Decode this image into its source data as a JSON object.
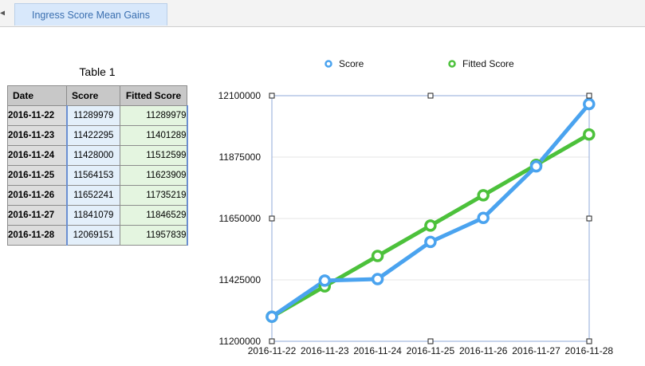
{
  "tabs": [
    {
      "label": "Ingress Score Mean Gains"
    }
  ],
  "table": {
    "title": "Table 1",
    "headers": [
      "Date",
      "Score",
      "Fitted Score"
    ],
    "rows": [
      {
        "date": "2016-11-22",
        "score": "11289979",
        "fitted": "11289979"
      },
      {
        "date": "2016-11-23",
        "score": "11422295",
        "fitted": "11401289"
      },
      {
        "date": "2016-11-24",
        "score": "11428000",
        "fitted": "11512599"
      },
      {
        "date": "2016-11-25",
        "score": "11564153",
        "fitted": "11623909"
      },
      {
        "date": "2016-11-26",
        "score": "11652241",
        "fitted": "11735219"
      },
      {
        "date": "2016-11-27",
        "score": "11841079",
        "fitted": "11846529"
      },
      {
        "date": "2016-11-28",
        "score": "12069151",
        "fitted": "11957839"
      }
    ]
  },
  "chart_data": {
    "type": "line",
    "title": "",
    "xlabel": "",
    "ylabel": "",
    "x": [
      "2016-11-22",
      "2016-11-23",
      "2016-11-24",
      "2016-11-25",
      "2016-11-26",
      "2016-11-27",
      "2016-11-28"
    ],
    "y_ticks": [
      "12100000",
      "11875000",
      "11650000",
      "11425000",
      "11200000"
    ],
    "ylim": [
      11200000,
      12100000
    ],
    "legend_position": "top",
    "grid": true,
    "series": [
      {
        "name": "Score",
        "color": "#4aa3ef",
        "values": [
          11289979,
          11422295,
          11428000,
          11564153,
          11652241,
          11841079,
          12069151
        ]
      },
      {
        "name": "Fitted Score",
        "color": "#4cc13b",
        "values": [
          11289979,
          11401289,
          11512599,
          11623909,
          11735219,
          11846529,
          11957839
        ]
      }
    ]
  }
}
